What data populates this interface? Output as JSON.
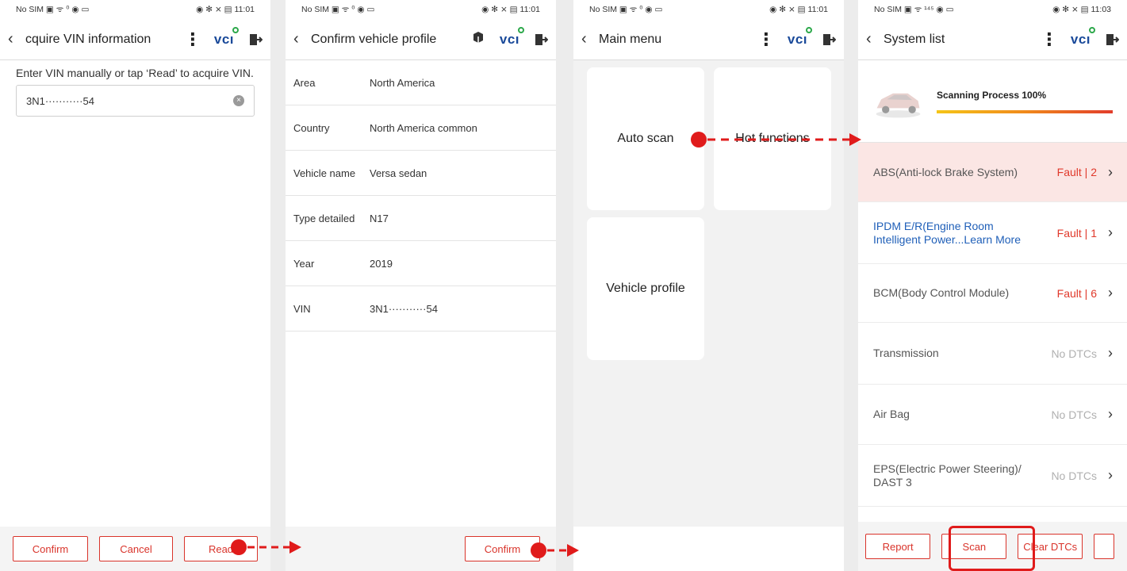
{
  "status_bar": {
    "p1": {
      "left": "No SIM ▣ ᯤ ⁰ ◉ ▭",
      "right": "◉ ✻ ⨯ ▤ 11:01"
    },
    "p2": {
      "left": "No SIM ▣ ᯤ ⁰ ◉ ▭",
      "right": "◉ ✻ ⨯ ▤ 11:01"
    },
    "p3": {
      "left": "No SIM ▣ ᯤ ⁰ ◉ ▭",
      "right": "◉ ✻ ⨯ ▤ 11:01"
    },
    "p4": {
      "left": "No SIM ▣ ᯤ ¹⁴⁵ ◉ ▭",
      "right": "◉ ✻ ⨯ ▤ 11:03"
    }
  },
  "vci_label": "VCI",
  "panel1": {
    "title": "cquire VIN information",
    "hint": "Enter VIN manually or tap ‘Read’ to acquire VIN.",
    "vin_value": "3N1···········54",
    "buttons": {
      "confirm": "Confirm",
      "cancel": "Cancel",
      "read": "Read"
    }
  },
  "panel2": {
    "title": "Confirm vehicle profile",
    "rows": [
      {
        "k": "Area",
        "v": "North America"
      },
      {
        "k": "Country",
        "v": "North America common"
      },
      {
        "k": "Vehicle name",
        "v": "Versa sedan"
      },
      {
        "k": "Type detailed",
        "v": "N17"
      },
      {
        "k": "Year",
        "v": "2019"
      },
      {
        "k": "VIN",
        "v": "3N1···········54"
      }
    ],
    "confirm": "Confirm"
  },
  "panel3": {
    "title": "Main menu",
    "tiles": {
      "auto_scan": "Auto scan",
      "hot_functions": "Hot functions",
      "vehicle_profile": "Vehicle profile"
    }
  },
  "panel4": {
    "title": "System list",
    "process": "Scanning Process 100%",
    "progress_fraction": 1.0,
    "systems": [
      {
        "name": "ABS(Anti-lock Brake System)",
        "status": "Fault | 2",
        "fault": true
      },
      {
        "name": "IPDM E/R(Engine Room Intelligent Power...",
        "learn": "Learn More",
        "status": "Fault | 1",
        "fault": true
      },
      {
        "name": "BCM(Body Control Module)",
        "status": "Fault | 6",
        "fault": true
      },
      {
        "name": "Transmission",
        "status": "No DTCs",
        "fault": false
      },
      {
        "name": "Air Bag",
        "status": "No DTCs",
        "fault": false
      },
      {
        "name": "EPS(Electric Power Steering)/ DAST 3",
        "status": "No DTCs",
        "fault": false
      }
    ],
    "buttons": {
      "report": "Report",
      "scan": "Scan",
      "clear": "Clear DTCs"
    }
  },
  "colors": {
    "accent": "#d9342b",
    "vci_blue": "#1a4a9a",
    "vci_green": "#2ca84a",
    "link_blue": "#1f5fb8",
    "annotation_red": "#e01b1b"
  }
}
